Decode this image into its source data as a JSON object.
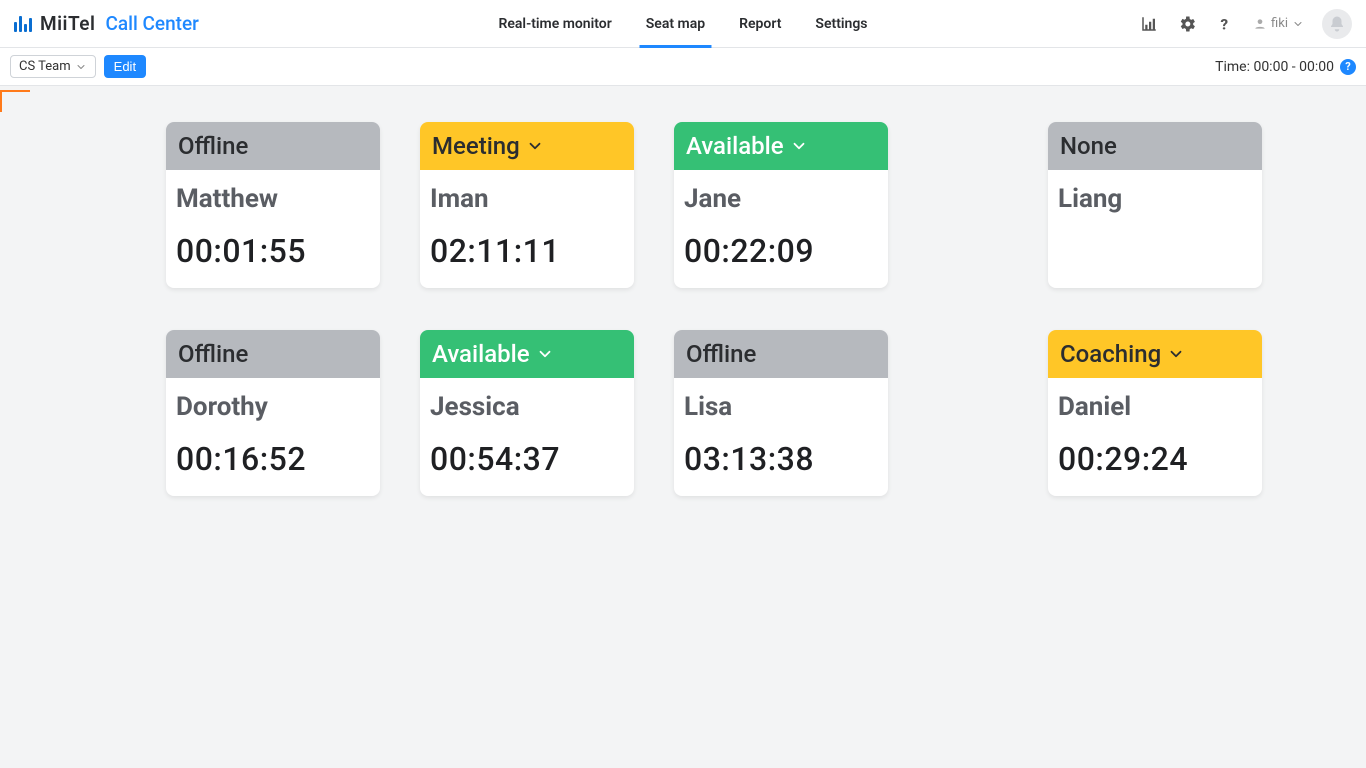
{
  "brand": {
    "name": "MiiTel",
    "product": "Call Center"
  },
  "nav": {
    "items": [
      "Real-time monitor",
      "Seat map",
      "Report",
      "Settings"
    ],
    "active_index": 1
  },
  "user": {
    "name": "fiki"
  },
  "subbar": {
    "team_label": "CS Team",
    "edit_label": "Edit",
    "time_label": "Time: 00:00 - 00:00"
  },
  "status_colors": {
    "Offline": "hd-grey",
    "None": "hd-grey",
    "Meeting": "hd-yellow",
    "Coaching": "hd-yellow",
    "Available": "hd-green"
  },
  "seats": [
    {
      "status": "Offline",
      "has_dropdown": false,
      "name": "Matthew",
      "time": "00:01:55"
    },
    {
      "status": "Meeting",
      "has_dropdown": true,
      "name": "Iman",
      "time": "02:11:11"
    },
    {
      "status": "Available",
      "has_dropdown": true,
      "name": "Jane",
      "time": "00:22:09"
    },
    {
      "status": "None",
      "has_dropdown": false,
      "name": "Liang",
      "time": ""
    },
    {
      "status": "Offline",
      "has_dropdown": false,
      "name": "Dorothy",
      "time": "00:16:52"
    },
    {
      "status": "Available",
      "has_dropdown": true,
      "name": "Jessica",
      "time": "00:54:37"
    },
    {
      "status": "Offline",
      "has_dropdown": false,
      "name": "Lisa",
      "time": "03:13:38"
    },
    {
      "status": "Coaching",
      "has_dropdown": true,
      "name": "Daniel",
      "time": "00:29:24"
    }
  ]
}
